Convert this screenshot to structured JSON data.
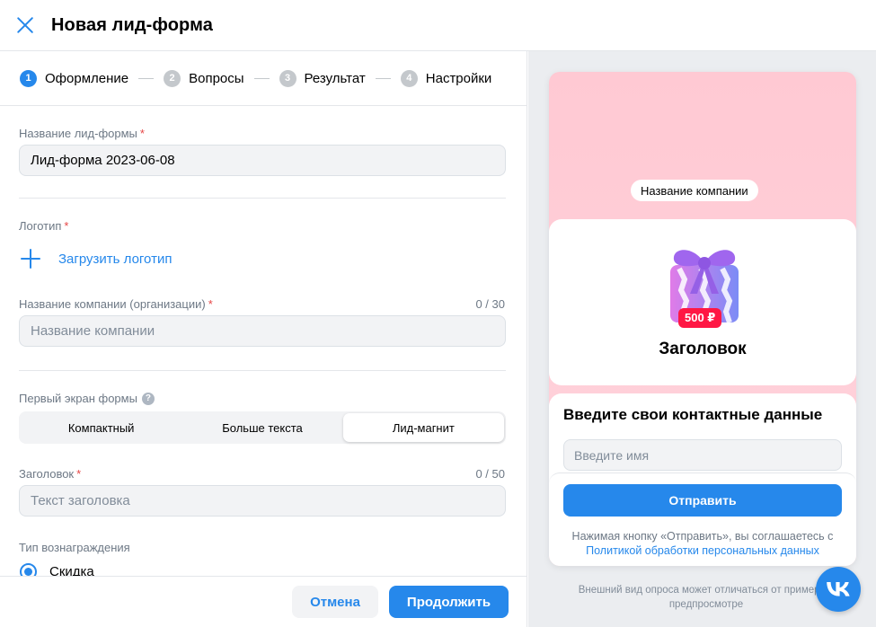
{
  "header": {
    "title": "Новая лид-форма"
  },
  "steps": [
    {
      "num": "1",
      "label": "Оформление"
    },
    {
      "num": "2",
      "label": "Вопросы"
    },
    {
      "num": "3",
      "label": "Результат"
    },
    {
      "num": "4",
      "label": "Настройки"
    }
  ],
  "form": {
    "form_name": {
      "label": "Название лид-формы",
      "required": "*",
      "value": "Лид-форма 2023-06-08"
    },
    "logo": {
      "label": "Логотип",
      "required": "*",
      "upload_label": "Загрузить логотип"
    },
    "company_name": {
      "label": "Название компании (организации)",
      "required": "*",
      "counter": "0 / 30",
      "placeholder": "Название компании"
    },
    "first_screen": {
      "label": "Первый экран формы",
      "help": "?",
      "options": [
        "Компактный",
        "Больше текста",
        "Лид-магнит"
      ],
      "selected": "Лид-магнит"
    },
    "heading": {
      "label": "Заголовок",
      "required": "*",
      "counter": "0 / 50",
      "placeholder": "Текст заголовка"
    },
    "reward_type": {
      "label": "Тип вознаграждения",
      "option_label": "Скидка"
    }
  },
  "footer": {
    "cancel_label": "Отмена",
    "continue_label": "Продолжить"
  },
  "preview": {
    "company_pill": "Название компании",
    "price_badge": "500 ₽",
    "title": "Заголовок",
    "contact_title": "Введите свои контактные данные",
    "name_placeholder": "Введите имя",
    "send_label": "Отправить",
    "consent_text": "Нажимая кнопку «Отправить», вы соглашаетесь с",
    "consent_link": "Политикой обработки персональных данных",
    "note": "Внешний вид опроса может отличаться от примера в предпросмотре"
  },
  "fab": {
    "label": "VK",
    "icon": "vk-logo-icon"
  },
  "colors": {
    "accent": "#2688eb",
    "required": "#e64646",
    "price": "#ff1744",
    "preview_bg": "#ffc9d3"
  }
}
